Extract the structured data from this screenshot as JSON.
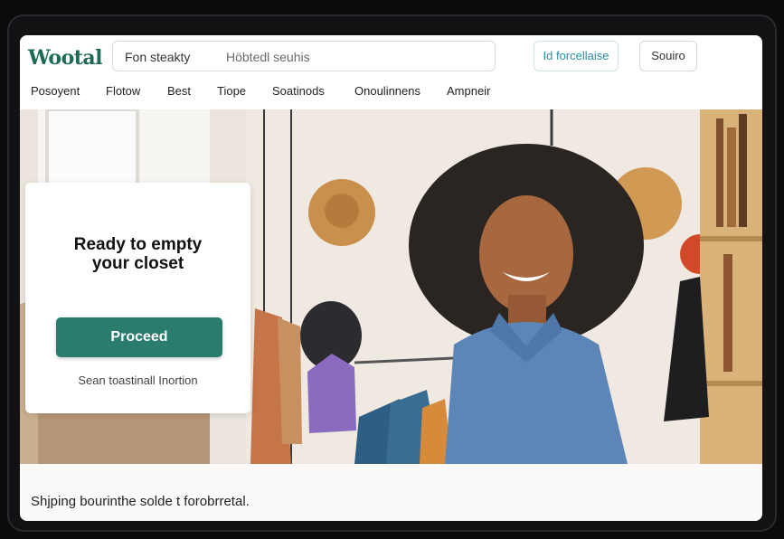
{
  "header": {
    "logo": "Wootal",
    "search": {
      "category": "Fon steakty",
      "placeholder": "Höbtedl seuhis"
    },
    "primary_action": "Id forcellaise",
    "secondary_action": "Souiro"
  },
  "nav": {
    "items": [
      "Posoyent",
      "Flotow",
      "Best",
      "Tiope",
      "Soatinods",
      "Onoulinnens",
      "Ampneir"
    ]
  },
  "hero": {
    "card": {
      "title_line1": "Ready to empty",
      "title_line2": "your closet",
      "button_label": "Proceed",
      "link_text": "Sean toastinall Inortion"
    }
  },
  "footer": {
    "text": "Shjping bourinthe solde t forobrretal."
  },
  "colors": {
    "brand": "#1b6b56",
    "button": "#2a7d6d",
    "accent": "#2a8fa3"
  }
}
